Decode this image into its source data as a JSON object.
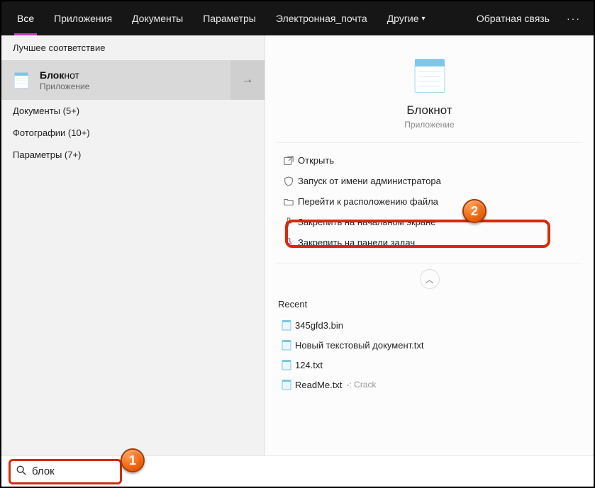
{
  "topbar": {
    "tabs": {
      "all": "Все",
      "apps": "Приложения",
      "documents": "Документы",
      "settings": "Параметры",
      "email": "Электронная_почта",
      "more": "Другие"
    },
    "feedback": "Обратная связь",
    "ellipsis": "···"
  },
  "left": {
    "best_match_header": "Лучшее соответствие",
    "best_match": {
      "title_bold": "Блок",
      "title_rest": "нот",
      "subtitle": "Приложение",
      "arrow": "→"
    },
    "categories": {
      "documents": "Документы (5+)",
      "photos": "Фотографии (10+)",
      "settings": "Параметры (7+)"
    }
  },
  "hero": {
    "title": "Блокнот",
    "subtitle": "Приложение"
  },
  "actions": {
    "open": "Открыть",
    "run_admin": "Запуск от имени администратора",
    "open_location": "Перейти к расположению файла",
    "pin_start": "Закрепить на начальном экране",
    "pin_taskbar": "Закрепить на панели задач"
  },
  "recent": {
    "header": "Recent",
    "items": [
      {
        "name": "345gfd3.bin",
        "loc": ""
      },
      {
        "name": "Новый текстовый документ.txt",
        "loc": ""
      },
      {
        "name": "124.txt",
        "loc": ""
      },
      {
        "name": "ReadMe.txt",
        "loc": "-: Crack"
      }
    ]
  },
  "search": {
    "query": "блок"
  },
  "badges": {
    "b1": "1",
    "b2": "2"
  }
}
